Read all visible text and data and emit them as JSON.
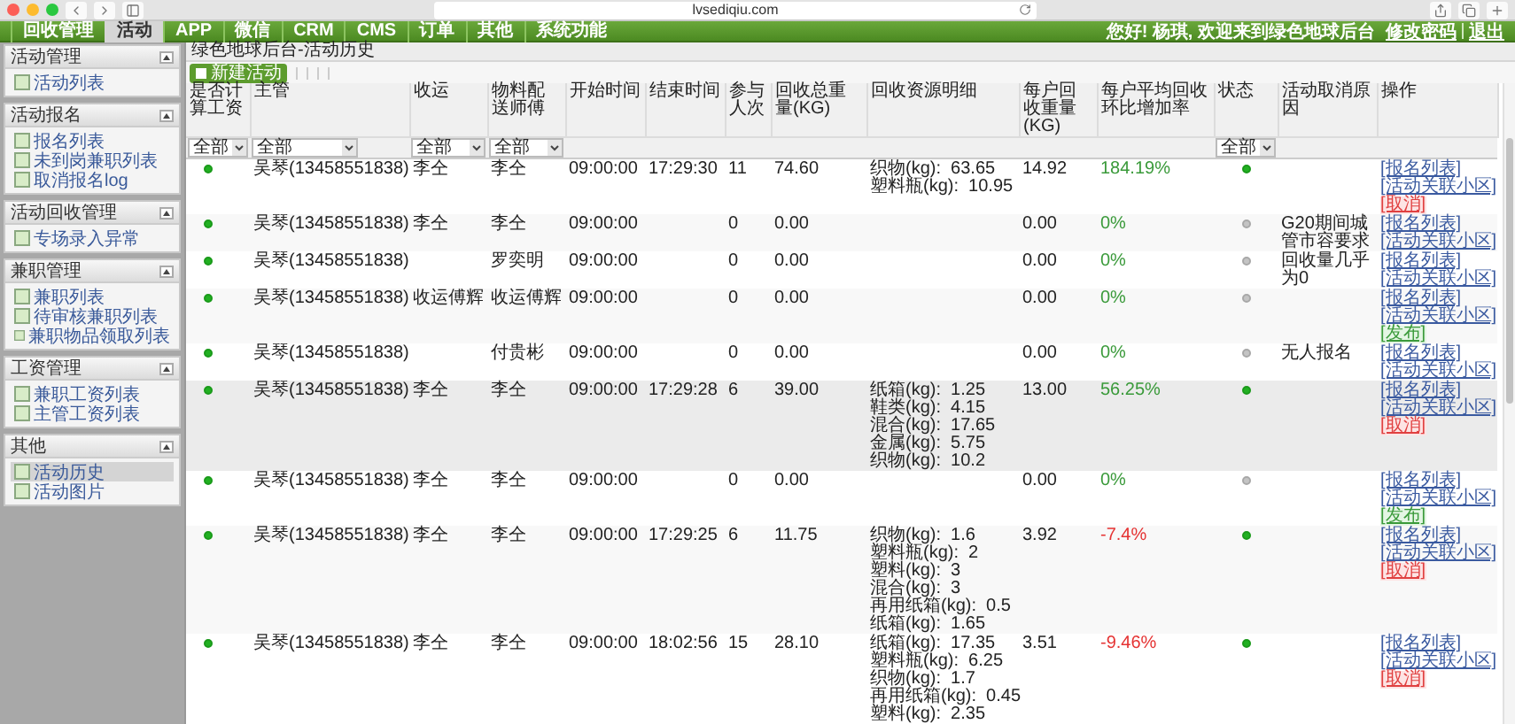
{
  "browser": {
    "url": "lvsediqiu.com"
  },
  "nav": {
    "tabs": [
      {
        "label": "回收管理",
        "selected": false
      },
      {
        "label": "活动",
        "selected": true
      },
      {
        "label": "APP",
        "selected": false
      },
      {
        "label": "微信",
        "selected": false
      },
      {
        "label": "CRM",
        "selected": false
      },
      {
        "label": "CMS",
        "selected": false
      },
      {
        "label": "订单",
        "selected": false
      },
      {
        "label": "其他",
        "selected": false
      },
      {
        "label": "系统功能",
        "selected": false
      }
    ],
    "greeting": "您好! 杨琪, 欢迎来到绿色地球后台",
    "links": [
      "修改密码",
      "退出"
    ]
  },
  "sidebar": {
    "sections": [
      {
        "title": "活动管理",
        "items": [
          {
            "label": "活动列表",
            "selected": false
          }
        ]
      },
      {
        "title": "活动报名",
        "items": [
          {
            "label": "报名列表",
            "selected": false
          },
          {
            "label": "未到岗兼职列表",
            "selected": false
          },
          {
            "label": "取消报名log",
            "selected": false
          }
        ]
      },
      {
        "title": "活动回收管理",
        "items": [
          {
            "label": "专场录入异常",
            "selected": false
          }
        ]
      },
      {
        "title": "兼职管理",
        "items": [
          {
            "label": "兼职列表",
            "selected": false
          },
          {
            "label": "待审核兼职列表",
            "selected": false
          },
          {
            "label": "兼职物品领取列表",
            "selected": false
          }
        ]
      },
      {
        "title": "工资管理",
        "items": [
          {
            "label": "兼职工资列表",
            "selected": false
          },
          {
            "label": "主管工资列表",
            "selected": false
          }
        ]
      },
      {
        "title": "其他",
        "items": [
          {
            "label": "活动历史",
            "selected": true
          },
          {
            "label": "活动图片",
            "selected": false
          }
        ]
      }
    ]
  },
  "breadcrumb": "绿色地球后台-活动历史",
  "toolbar": {
    "button": "新建活动"
  },
  "table": {
    "columns": [
      {
        "label": "是否计算工资",
        "filter": "全部"
      },
      {
        "label": "主管",
        "filter": "全部"
      },
      {
        "label": "收运",
        "filter": "全部"
      },
      {
        "label": "物料配送师傅",
        "filter": "全部"
      },
      {
        "label": "开始时间"
      },
      {
        "label": "结束时间"
      },
      {
        "label": "参与人次"
      },
      {
        "label": "回收总重量(KG)"
      },
      {
        "label": "回收资源明细"
      },
      {
        "label": "每户回收重量(KG)"
      },
      {
        "label": "每户平均回收环比增加率"
      },
      {
        "label": "状态",
        "filter": "全部"
      },
      {
        "label": "活动取消原因"
      },
      {
        "label": "操作"
      }
    ],
    "rows": [
      {
        "selected": false,
        "calc_salary": true,
        "supervisor": "吴琴(13458551838)",
        "collector": "李仝",
        "deliverer": "李仝",
        "start": "09:00:00",
        "end": "17:29:30",
        "participants": "11",
        "total": "74.60",
        "details": [
          "织物(kg):  63.65",
          "塑料瓶(kg):  10.95"
        ],
        "per_household": "14.92",
        "rate": "184.19%",
        "rate_negative": false,
        "active": true,
        "actions": [
          {
            "label": "[报名列表]",
            "kind": "link"
          },
          {
            "label": "[活动关联小区]",
            "kind": "link"
          },
          {
            "label": "[取消]",
            "kind": "cancel"
          }
        ]
      },
      {
        "selected": false,
        "calc_salary": true,
        "supervisor": "吴琴(13458551838)",
        "collector": "李仝",
        "deliverer": "李仝",
        "start": "09:00:00",
        "participants": "0",
        "total": "0.00",
        "per_household": "0.00",
        "rate": "0%",
        "rate_negative": false,
        "active": false,
        "reason": "G20期间城管市容要求",
        "actions": [
          {
            "label": "[报名列表]",
            "kind": "link"
          },
          {
            "label": "[活动关联小区]",
            "kind": "link"
          }
        ]
      },
      {
        "selected": false,
        "calc_salary": true,
        "supervisor": "吴琴(13458551838)",
        "deliverer": "罗奕明",
        "start": "09:00:00",
        "participants": "0",
        "total": "0.00",
        "per_household": "0.00",
        "rate": "0%",
        "rate_negative": false,
        "active": false,
        "reason": "回收量几乎为0",
        "actions": [
          {
            "label": "[报名列表]",
            "kind": "link"
          },
          {
            "label": "[活动关联小区]",
            "kind": "link"
          }
        ]
      },
      {
        "selected": false,
        "calc_salary": true,
        "supervisor": "吴琴(13458551838)",
        "collector": "收运傅辉",
        "deliverer": "收运傅辉",
        "start": "09:00:00",
        "participants": "0",
        "total": "0.00",
        "per_household": "0.00",
        "rate": "0%",
        "rate_negative": false,
        "active": false,
        "actions": [
          {
            "label": "[报名列表]",
            "kind": "link"
          },
          {
            "label": "[活动关联小区]",
            "kind": "link"
          },
          {
            "label": "[发布]",
            "kind": "publish"
          }
        ]
      },
      {
        "selected": false,
        "calc_salary": true,
        "supervisor": "吴琴(13458551838)",
        "deliverer": "付贵彬",
        "start": "09:00:00",
        "participants": "0",
        "total": "0.00",
        "per_household": "0.00",
        "rate": "0%",
        "rate_negative": false,
        "active": false,
        "reason": "无人报名",
        "actions": [
          {
            "label": "[报名列表]",
            "kind": "link"
          },
          {
            "label": "[活动关联小区]",
            "kind": "link"
          }
        ]
      },
      {
        "selected": true,
        "calc_salary": true,
        "supervisor": "吴琴(13458551838)",
        "collector": "李仝",
        "deliverer": "李仝",
        "start": "09:00:00",
        "end": "17:29:28",
        "participants": "6",
        "total": "39.00",
        "details": [
          "纸箱(kg):  1.25",
          "鞋类(kg):  4.15",
          "混合(kg):  17.65",
          "金属(kg):  5.75",
          "织物(kg):  10.2"
        ],
        "per_household": "13.00",
        "rate": "56.25%",
        "rate_negative": false,
        "active": true,
        "actions": [
          {
            "label": "[报名列表]",
            "kind": "link"
          },
          {
            "label": "[活动关联小区]",
            "kind": "link"
          },
          {
            "label": "[取消]",
            "kind": "cancel"
          }
        ]
      },
      {
        "selected": false,
        "calc_salary": true,
        "supervisor": "吴琴(13458551838)",
        "collector": "李仝",
        "deliverer": "李仝",
        "start": "09:00:00",
        "participants": "0",
        "total": "0.00",
        "per_household": "0.00",
        "rate": "0%",
        "rate_negative": false,
        "active": false,
        "actions": [
          {
            "label": "[报名列表]",
            "kind": "link"
          },
          {
            "label": "[活动关联小区]",
            "kind": "link"
          },
          {
            "label": "[发布]",
            "kind": "publish"
          }
        ]
      },
      {
        "selected": false,
        "calc_salary": true,
        "supervisor": "吴琴(13458551838)",
        "collector": "李仝",
        "deliverer": "李仝",
        "start": "09:00:00",
        "end": "17:29:25",
        "participants": "6",
        "total": "11.75",
        "details": [
          "织物(kg):  1.6",
          "塑料瓶(kg):  2",
          "塑料(kg):  3",
          "混合(kg):  3",
          "再用纸箱(kg):  0.5",
          "纸箱(kg):  1.65"
        ],
        "per_household": "3.92",
        "rate": "-7.4%",
        "rate_negative": true,
        "active": true,
        "actions": [
          {
            "label": "[报名列表]",
            "kind": "link"
          },
          {
            "label": "[活动关联小区]",
            "kind": "link"
          },
          {
            "label": "[取消]",
            "kind": "cancel"
          }
        ]
      },
      {
        "selected": false,
        "calc_salary": true,
        "supervisor": "吴琴(13458551838)",
        "collector": "李仝",
        "deliverer": "李仝",
        "start": "09:00:00",
        "end": "18:02:56",
        "participants": "15",
        "total": "28.10",
        "details": [
          "纸箱(kg):  17.35",
          "塑料瓶(kg):  6.25",
          "织物(kg):  1.7",
          "再用纸箱(kg):  0.45",
          "塑料(kg):  2.35"
        ],
        "per_household": "3.51",
        "rate": "-9.46%",
        "rate_negative": true,
        "active": true,
        "actions": [
          {
            "label": "[报名列表]",
            "kind": "link"
          },
          {
            "label": "[活动关联小区]",
            "kind": "link"
          },
          {
            "label": "[取消]",
            "kind": "cancel"
          }
        ]
      }
    ]
  }
}
